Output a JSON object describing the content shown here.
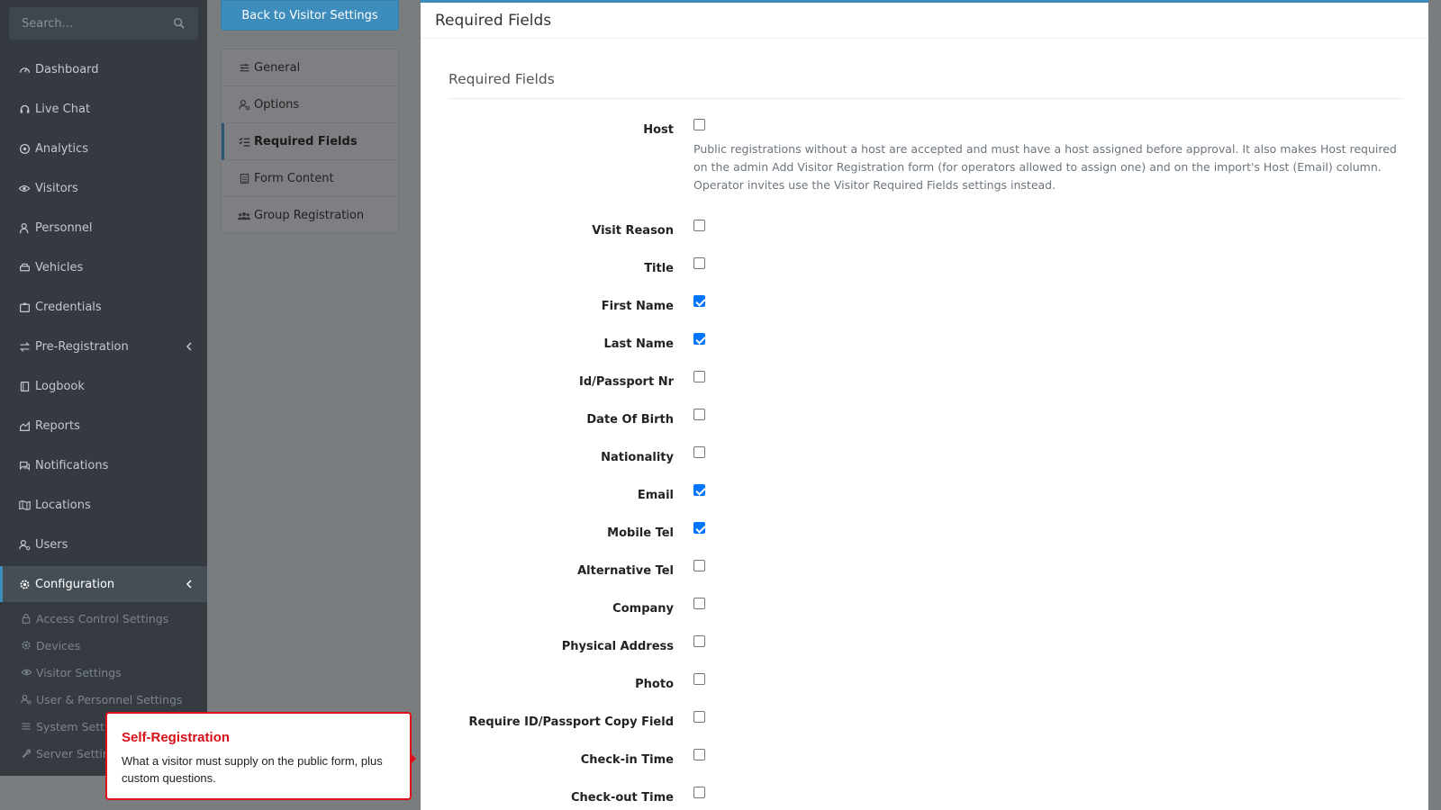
{
  "sidebar": {
    "search_placeholder": "Search...",
    "items": [
      {
        "label": "Dashboard",
        "icon": "gauge-icon"
      },
      {
        "label": "Live Chat",
        "icon": "headset-icon"
      },
      {
        "label": "Analytics",
        "icon": "target-icon"
      },
      {
        "label": "Visitors",
        "icon": "eye-icon"
      },
      {
        "label": "Personnel",
        "icon": "user-tie-icon"
      },
      {
        "label": "Vehicles",
        "icon": "car-icon"
      },
      {
        "label": "Credentials",
        "icon": "id-card-icon"
      },
      {
        "label": "Pre-Registration",
        "icon": "exchange-icon"
      },
      {
        "label": "Logbook",
        "icon": "book-icon"
      },
      {
        "label": "Reports",
        "icon": "chart-area-icon"
      },
      {
        "label": "Notifications",
        "icon": "comments-icon"
      },
      {
        "label": "Locations",
        "icon": "map-icon"
      },
      {
        "label": "Users",
        "icon": "users-cog-icon"
      },
      {
        "label": "Configuration",
        "icon": "gear-icon"
      }
    ],
    "sub_items": [
      {
        "label": "Access Control Settings",
        "icon": "lock-icon"
      },
      {
        "label": "Devices",
        "icon": "gear-icon"
      },
      {
        "label": "Visitor Settings",
        "icon": "eye-icon"
      },
      {
        "label": "User & Personnel Settings",
        "icon": "users-cog-icon"
      },
      {
        "label": "System Settings",
        "icon": "sliders-icon"
      },
      {
        "label": "Server Settings",
        "icon": "wrench-icon"
      }
    ]
  },
  "subnav": {
    "back_label": "Back to Visitor Settings",
    "items": [
      {
        "label": "General",
        "icon": "sliders-icon"
      },
      {
        "label": "Options",
        "icon": "users-cog-icon"
      },
      {
        "label": "Required Fields",
        "icon": "list-check-icon",
        "active": true
      },
      {
        "label": "Form Content",
        "icon": "file-icon"
      },
      {
        "label": "Group Registration",
        "icon": "users-icon"
      }
    ]
  },
  "card": {
    "header": "Required Fields",
    "section_title": "Required Fields",
    "host_help": "Public registrations without a host are accepted and must have a host assigned before approval. It also makes Host required on the admin Add Visitor Registration form (for operators allowed to assign one) and on the import's Host (Email) column. Operator invites use the Visitor Required Fields settings instead.",
    "fields": [
      {
        "label": "Host",
        "checked": false
      },
      {
        "label": "Visit Reason",
        "checked": false
      },
      {
        "label": "Title",
        "checked": false
      },
      {
        "label": "First Name",
        "checked": true
      },
      {
        "label": "Last Name",
        "checked": true
      },
      {
        "label": "Id/Passport Nr",
        "checked": false
      },
      {
        "label": "Date Of Birth",
        "checked": false
      },
      {
        "label": "Nationality",
        "checked": false
      },
      {
        "label": "Email",
        "checked": true
      },
      {
        "label": "Mobile Tel",
        "checked": true
      },
      {
        "label": "Alternative Tel",
        "checked": false
      },
      {
        "label": "Company",
        "checked": false
      },
      {
        "label": "Physical Address",
        "checked": false
      },
      {
        "label": "Photo",
        "checked": false
      },
      {
        "label": "Require ID/Passport Copy Field",
        "checked": false
      },
      {
        "label": "Check-in Time",
        "checked": false
      },
      {
        "label": "Check-out Time",
        "checked": false
      }
    ]
  },
  "tooltip": {
    "title": "Self-Registration",
    "body": "What a visitor must supply on the public form, plus custom questions."
  },
  "colors": {
    "sidebar_bg": "#343a40",
    "accent": "#3c8dbc",
    "checkbox_checked": "#0075ff",
    "tooltip_border": "#e0101a"
  }
}
